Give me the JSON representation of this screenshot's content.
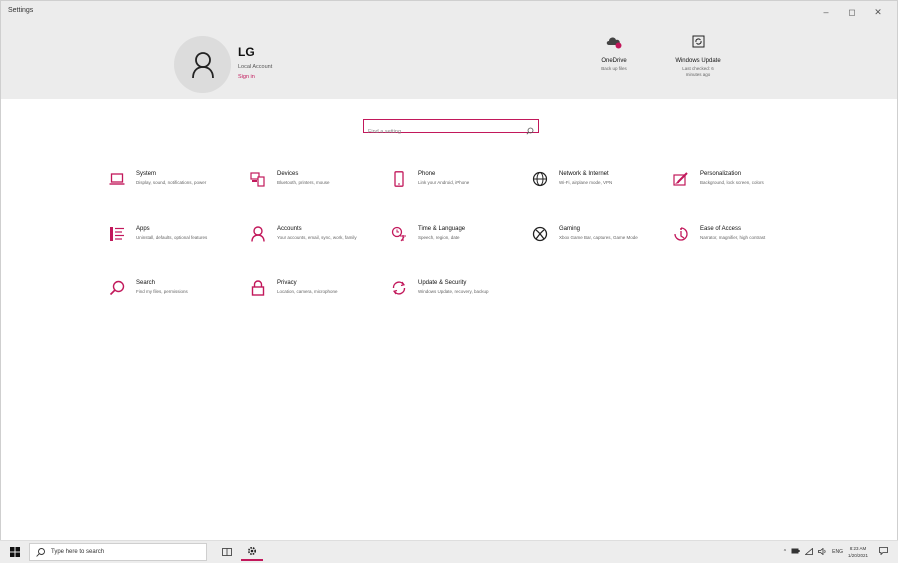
{
  "window": {
    "title": "Settings",
    "controls": [
      "–",
      "◻",
      "✕"
    ]
  },
  "account": {
    "name": "LG",
    "type": "Local Account",
    "signin": "Sign in"
  },
  "header_tiles": [
    {
      "title": "OneDrive",
      "sub": "Back up files"
    },
    {
      "title": "Windows Update",
      "sub": "Last checked: 6 minutes ago"
    }
  ],
  "search": {
    "placeholder": "Find a setting"
  },
  "accent": "#c2185b",
  "categories": [
    {
      "name": "System",
      "desc": "Display, sound, notifications, power",
      "icon": "laptop-icon"
    },
    {
      "name": "Devices",
      "desc": "Bluetooth, printers, mouse",
      "icon": "devices-icon"
    },
    {
      "name": "Phone",
      "desc": "Link your Android, iPhone",
      "icon": "phone-icon"
    },
    {
      "name": "Network & Internet",
      "desc": "Wi-Fi, airplane mode, VPN",
      "icon": "globe-icon"
    },
    {
      "name": "Personalization",
      "desc": "Background, lock screen, colors",
      "icon": "paint-icon"
    },
    {
      "name": "Apps",
      "desc": "Uninstall, defaults, optional features",
      "icon": "apps-list-icon"
    },
    {
      "name": "Accounts",
      "desc": "Your accounts, email, sync, work, family",
      "icon": "person-icon"
    },
    {
      "name": "Time & Language",
      "desc": "Speech, region, date",
      "icon": "time-language-icon"
    },
    {
      "name": "Gaming",
      "desc": "Xbox Game Bar, captures, Game Mode",
      "icon": "xbox-icon"
    },
    {
      "name": "Ease of Access",
      "desc": "Narrator, magnifier, high contrast",
      "icon": "ease-of-access-icon"
    },
    {
      "name": "Search",
      "desc": "Find my files, permissions",
      "icon": "search-icon"
    },
    {
      "name": "Privacy",
      "desc": "Location, camera, microphone",
      "icon": "lock-icon"
    },
    {
      "name": "Update & Security",
      "desc": "Windows Update, recovery, backup",
      "icon": "update-icon"
    }
  ],
  "taskbar": {
    "search_text": "Type here to search",
    "language": "ENG",
    "time": "8:23 AM",
    "date": "1/20/2021"
  }
}
